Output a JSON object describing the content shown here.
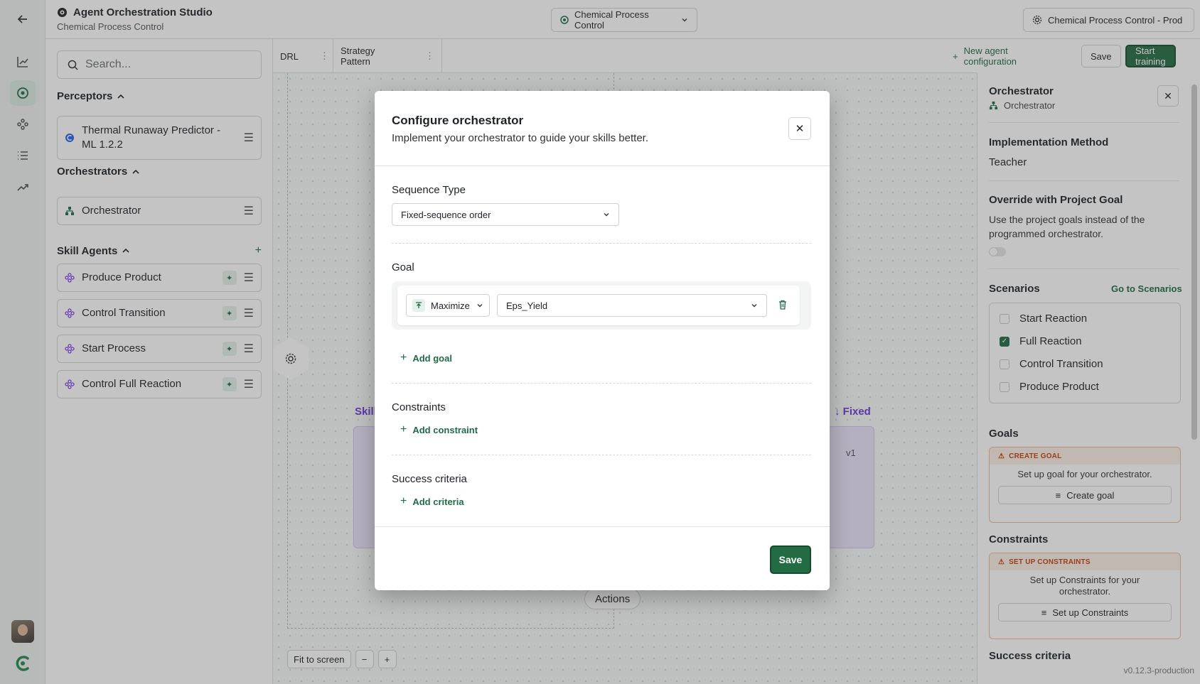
{
  "header": {
    "app_title": "Agent Orchestration Studio",
    "app_subtitle": "Chemical Process Control",
    "project_selector": "Chemical Process Control",
    "environment": "Chemical Process Control - Prod"
  },
  "left_panel": {
    "search_placeholder": "Search...",
    "perceptors_title": "Perceptors",
    "perceptors": [
      {
        "label": "Thermal Runaway Predictor - ML 1.2.2"
      }
    ],
    "orchestrators_title": "Orchestrators",
    "orchestrators": [
      {
        "label": "Orchestrator"
      }
    ],
    "skills_title": "Skill Agents",
    "skills": [
      {
        "label": "Produce Product"
      },
      {
        "label": "Control Transition"
      },
      {
        "label": "Start Process"
      },
      {
        "label": "Control Full Reaction"
      }
    ]
  },
  "tabs": {
    "items": [
      {
        "label": "DRL"
      },
      {
        "label": "Strategy Pattern"
      }
    ],
    "new_config": "New agent configuration",
    "save": "Save",
    "start_training": "Start training"
  },
  "canvas": {
    "skill_label": "Skill",
    "fixed_label": "Fixed",
    "version_label": "v1",
    "actions_label": "Actions",
    "fit_to_screen": "Fit to screen",
    "zoom_out": "−",
    "zoom_in": "+"
  },
  "right_panel": {
    "title": "Orchestrator",
    "subtitle": "Orchestrator",
    "impl_label": "Implementation Method",
    "impl_value": "Teacher",
    "override_title": "Override with Project Goal",
    "override_desc": "Use the project goals instead of the programmed orchestrator.",
    "override_enabled": false,
    "scenarios_title": "Scenarios",
    "go_to_scenarios": "Go to Scenarios",
    "scenarios": [
      {
        "label": "Start Reaction",
        "checked": false
      },
      {
        "label": "Full Reaction",
        "checked": true
      },
      {
        "label": "Control Transition",
        "checked": false
      },
      {
        "label": "Produce Product",
        "checked": false
      }
    ],
    "goals_title": "Goals",
    "goals_warning": "CREATE GOAL",
    "goals_desc": "Set up goal for your orchestrator.",
    "goals_button": "Create goal",
    "constraints_title": "Constraints",
    "constraints_warning": "SET UP CONSTRAINTS",
    "constraints_desc": "Set up Constraints for your orchestrator.",
    "constraints_button": "Set up Constraints",
    "success_title": "Success criteria"
  },
  "version": "v0.12.3-production",
  "modal": {
    "title": "Configure orchestrator",
    "subtitle": "Implement your orchestrator to guide your skills better.",
    "sequence_label": "Sequence Type",
    "sequence_value": "Fixed-sequence order",
    "goal_label": "Goal",
    "goal_direction": "Maximize",
    "goal_metric": "Eps_Yield",
    "add_goal": "Add goal",
    "constraints_label": "Constraints",
    "add_constraint": "Add constraint",
    "success_label": "Success criteria",
    "add_criteria": "Add criteria",
    "save": "Save"
  },
  "colors": {
    "accent": "#1e6b45",
    "skill_purple": "#6b39d6",
    "warning": "#c2410c"
  }
}
